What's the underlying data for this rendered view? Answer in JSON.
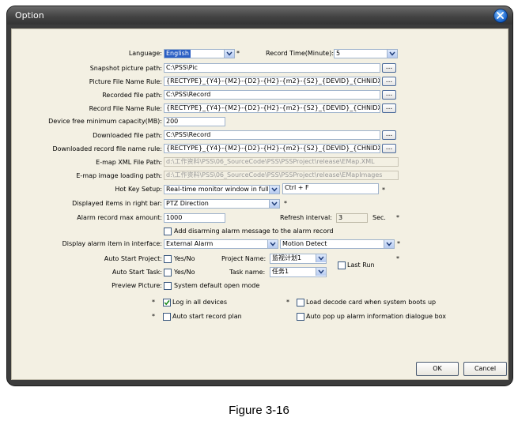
{
  "window": {
    "title": "Option",
    "close_icon": "close-icon"
  },
  "language": {
    "label": "Language:",
    "value": "English",
    "required": "*"
  },
  "record_time": {
    "label": "Record Time(Minute):",
    "value": "5"
  },
  "snapshot_path": {
    "label": "Snapshot picture path:",
    "value": "C:\\PSS\\Pic",
    "browse": "..."
  },
  "picture_name_rule": {
    "label": "Picture File Name Rule:",
    "value": "{RECTYPE}_{Y4}-{M2}-{D2}-{H2}-{m2}-{S2}_{DEVID}_{CHNIDX}.BMP",
    "browse": "..."
  },
  "recorded_path": {
    "label": "Recorded file  path:",
    "value": "C:\\PSS\\Record",
    "browse": "..."
  },
  "record_name_rule": {
    "label": "Record File Name Rule:",
    "value": "{RECTYPE}_{Y4}-{M2}-{D2}-{H2}-{m2}-{S2}_{DEVID}_{CHNIDX}.dav",
    "browse": "..."
  },
  "free_capacity": {
    "label": "Device free minimum capacity(MB):",
    "value": "200"
  },
  "downloaded_path": {
    "label": "Downloaded file path:",
    "value": "C:\\PSS\\Record",
    "browse": "..."
  },
  "downloaded_name_rule": {
    "label": "Downloaded record file name rule:",
    "value": "{RECTYPE}_{Y4}-{M2}-{D2}-{H2}-{m2}-{S2}_{DEVID}_{CHNIDX}.dav",
    "browse": "..."
  },
  "emap_xml": {
    "label": "E-map XML File Path:",
    "value": "d:\\工作资料\\PSS\\06_SourceCode\\PSS\\PSSProject\\release\\EMap.XML"
  },
  "emap_image": {
    "label": "E-map image loading path:",
    "value": "d:\\工作资料\\PSS\\06_SourceCode\\PSS\\PSSProject\\release\\EMapImages"
  },
  "hotkey": {
    "label": "Hot Key Setup:",
    "value": "Real-time monitor window in full sc",
    "key": "Ctrl + F",
    "required": "*"
  },
  "right_bar": {
    "label": "Displayed items in right bar:",
    "value": "PTZ Direction",
    "required": "*"
  },
  "alarm_record_max": {
    "label": "Alarm record max amount:",
    "value": "1000"
  },
  "refresh_interval": {
    "label": "Refresh interval:",
    "value": "3",
    "unit": "Sec.",
    "required": "*"
  },
  "add_disarm_msg": {
    "label": "Add disarming alarm message to the alarm record",
    "checked": false
  },
  "display_alarm": {
    "label": "Display alarm item in interface:",
    "value1": "External Alarm",
    "value2": "Motion Detect",
    "required": "*"
  },
  "auto_start_project": {
    "label": "Auto Start Project:",
    "check_label": "Yes/No",
    "checked": false,
    "name_label": "Project Name:",
    "name_value": "监视计划1",
    "required": "*"
  },
  "last_run": {
    "label": "Last Run",
    "checked": false
  },
  "auto_start_task": {
    "label": "Auto Start Task:",
    "check_label": "Yes/No",
    "checked": false,
    "name_label": "Task name:",
    "name_value": "任务1"
  },
  "preview_picture": {
    "label": "Preview Picture:",
    "check_label": "System default open mode",
    "checked": false
  },
  "options": {
    "log_all": {
      "label": "Log in all devices",
      "checked": true,
      "required": "*"
    },
    "load_decode": {
      "label": "Load decode card when system boots up",
      "checked": false,
      "required": "*"
    },
    "auto_record": {
      "label": "Auto start record plan",
      "checked": false,
      "required": "*"
    },
    "auto_popup": {
      "label": "Auto pop up alarm information dialogue box",
      "checked": false
    }
  },
  "buttons": {
    "ok": "OK",
    "cancel": "Cancel"
  },
  "caption": "Figure 3-16",
  "colors": {
    "frame": "#3c3c3c",
    "panel": "#f3f0e3",
    "selection": "#2b5fc4",
    "field_border": "#9fb3cc"
  }
}
